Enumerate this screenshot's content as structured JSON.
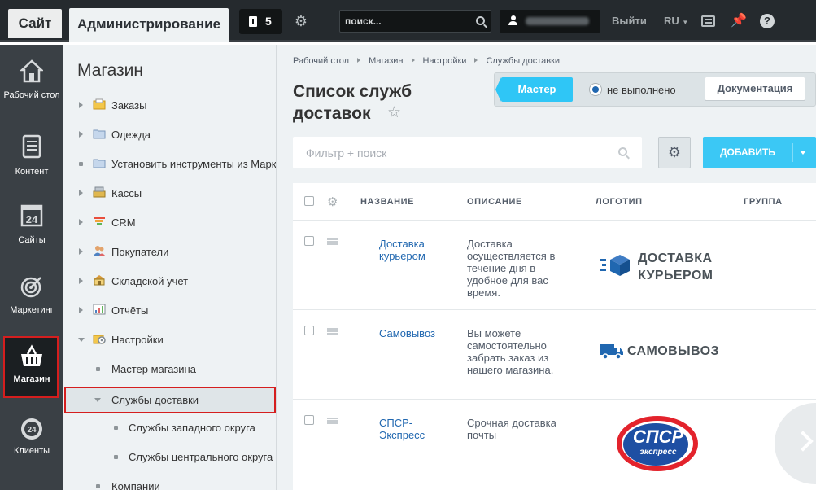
{
  "topbar": {
    "site_tab": "Сайт",
    "admin_tab": "Администрирование",
    "notifications_count": "5",
    "search_placeholder": "поиск...",
    "logout": "Выйти",
    "language": "RU"
  },
  "left_menu": [
    {
      "label": "Рабочий стол",
      "icon": "house-icon"
    },
    {
      "label": "Контент",
      "icon": "document-icon"
    },
    {
      "label": "Сайты",
      "icon": "calendar-24-icon"
    },
    {
      "label": "Маркетинг",
      "icon": "target-icon"
    },
    {
      "label": "Магазин",
      "icon": "basket-icon"
    },
    {
      "label": "Клиенты",
      "icon": "badge-24-icon"
    }
  ],
  "tree": {
    "title": "Магазин",
    "items": [
      {
        "label": "Заказы",
        "icon": "orders-icon"
      },
      {
        "label": "Одежда",
        "icon": "folder-icon"
      },
      {
        "label": "Установить инструменты из Маркетплейса",
        "icon": "folder-icon"
      },
      {
        "label": "Кассы",
        "icon": "cash-register-icon"
      },
      {
        "label": "CRM",
        "icon": "crm-funnel-icon"
      },
      {
        "label": "Покупатели",
        "icon": "customers-icon"
      },
      {
        "label": "Складской учет",
        "icon": "warehouse-icon"
      },
      {
        "label": "Отчёты",
        "icon": "reports-icon"
      },
      {
        "label": "Настройки",
        "icon": "settings-folder-icon"
      },
      {
        "label": "Мастер магазина"
      },
      {
        "label": "Службы доставки"
      },
      {
        "label": "Службы западного округа"
      },
      {
        "label": "Службы центрального округа"
      },
      {
        "label": "Компании"
      }
    ]
  },
  "breadcrumb": [
    "Рабочий стол",
    "Магазин",
    "Настройки",
    "Службы доставки"
  ],
  "page_title": "Список служб доставок",
  "wizard": {
    "master_label": "Мастер",
    "status": "не выполнено",
    "docs_label": "Документация"
  },
  "filter_placeholder": "Фильтр + поиск",
  "add_button": "ДОБАВИТЬ",
  "grid": {
    "columns": [
      "НАЗВАНИЕ",
      "ОПИСАНИЕ",
      "ЛОГОТИП",
      "ГРУППА"
    ],
    "rows": [
      {
        "name": "Доставка курьером",
        "description": "Доставка осуществляется в течение дня в удобное для вас время.",
        "logo_line1": "ДОСТАВКА",
        "logo_line2": "КУРЬЕРОМ"
      },
      {
        "name": "Самовывоз",
        "description": "Вы можете самостоятельно забрать заказ из нашего магазина.",
        "logo_line1": "САМОВЫВОЗ"
      },
      {
        "name": "СПСР-Экспресс",
        "description": "Срочная доставка почты",
        "logo_line1": "СПСР",
        "logo_line2": "экспресс"
      }
    ]
  },
  "colors": {
    "accent": "#3bc8f5",
    "link": "#2067b0",
    "highlight": "#d51e1e",
    "spsr_red": "#e3232c",
    "spsr_blue": "#1e4fa3"
  }
}
